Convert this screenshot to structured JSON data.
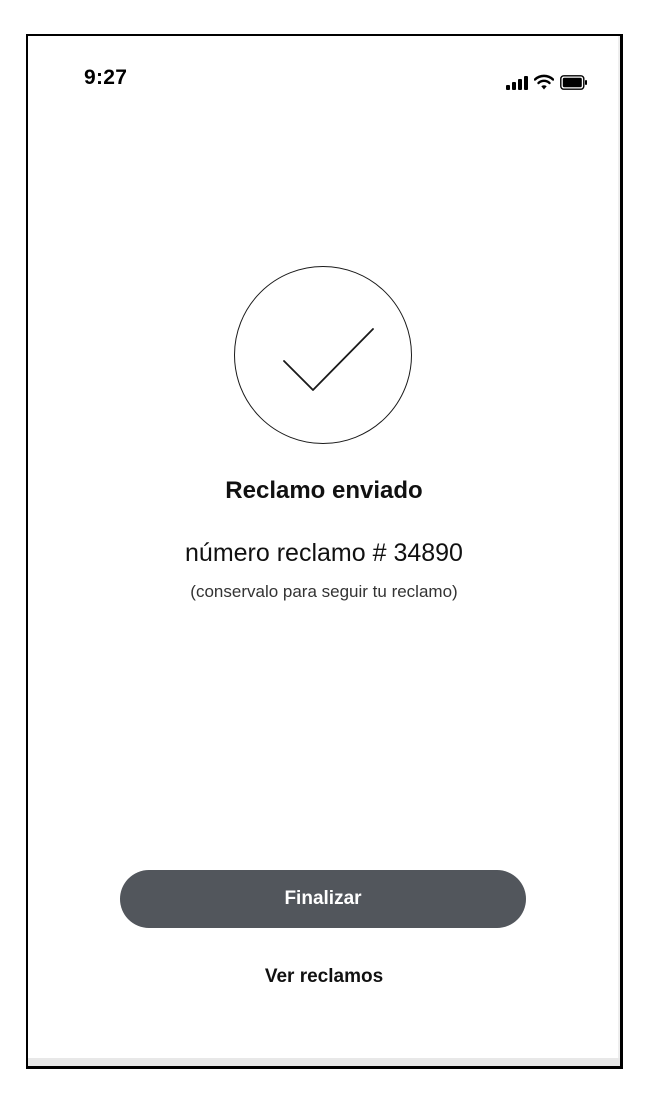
{
  "status_bar": {
    "time": "9:27",
    "icons": [
      "signal-icon",
      "wifi-icon",
      "battery-icon"
    ]
  },
  "confirmation": {
    "icon": "checkmark-icon",
    "title": "Reclamo enviado",
    "claim_number": "número reclamo # 34890",
    "hint": "(conservalo para seguir tu reclamo)"
  },
  "actions": {
    "primary_label": "Finalizar",
    "secondary_label": "Ver reclamos"
  },
  "colors": {
    "primary_button_bg": "#52565c",
    "primary_button_text": "#ffffff",
    "text": "#111111"
  }
}
